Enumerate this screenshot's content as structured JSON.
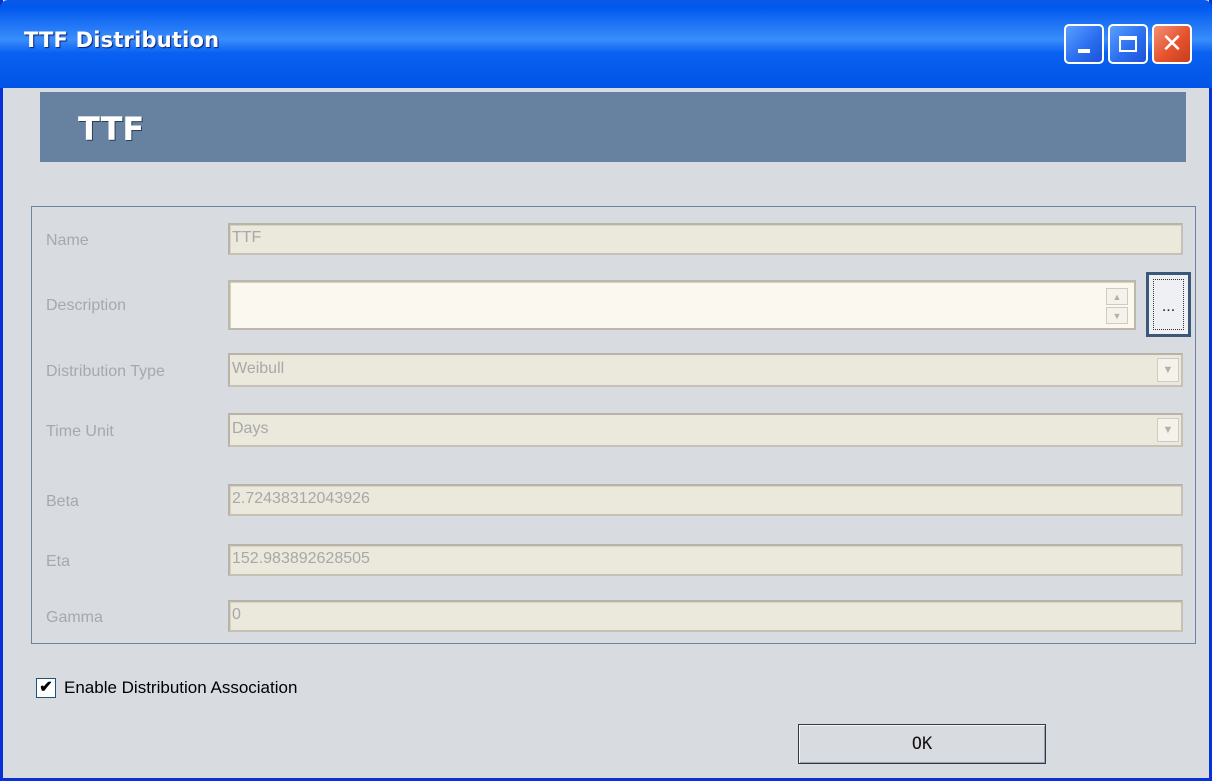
{
  "window": {
    "title": "TTF Distribution",
    "controls": [
      "minimize-icon",
      "maximize-icon",
      "close-icon"
    ]
  },
  "header": {
    "title": "TTF"
  },
  "fields": {
    "name_label": "Name",
    "name_value": "TTF",
    "description_label": "Description",
    "description_value": "",
    "description_button": "...",
    "distribution_type_label": "Distribution Type",
    "distribution_type_value": "Weibull",
    "time_unit_label": "Time Unit",
    "time_unit_value": "Days",
    "beta_label": "Beta",
    "beta_value": "2.72438312043926",
    "eta_label": "Eta",
    "eta_value": "152.983892628505",
    "gamma_label": "Gamma",
    "gamma_value": "0"
  },
  "options": {
    "enable_distribution_association_label": "Enable Distribution Association",
    "enable_distribution_association_checked": true
  },
  "actions": {
    "ok_label": "OK"
  },
  "colors": {
    "titlebar": "#0058ee",
    "header_band": "#6682a0",
    "window_bg": "#d8dce1",
    "disabled_field_bg": "#ebe8dc",
    "disabled_text": "#a6a8aa"
  }
}
